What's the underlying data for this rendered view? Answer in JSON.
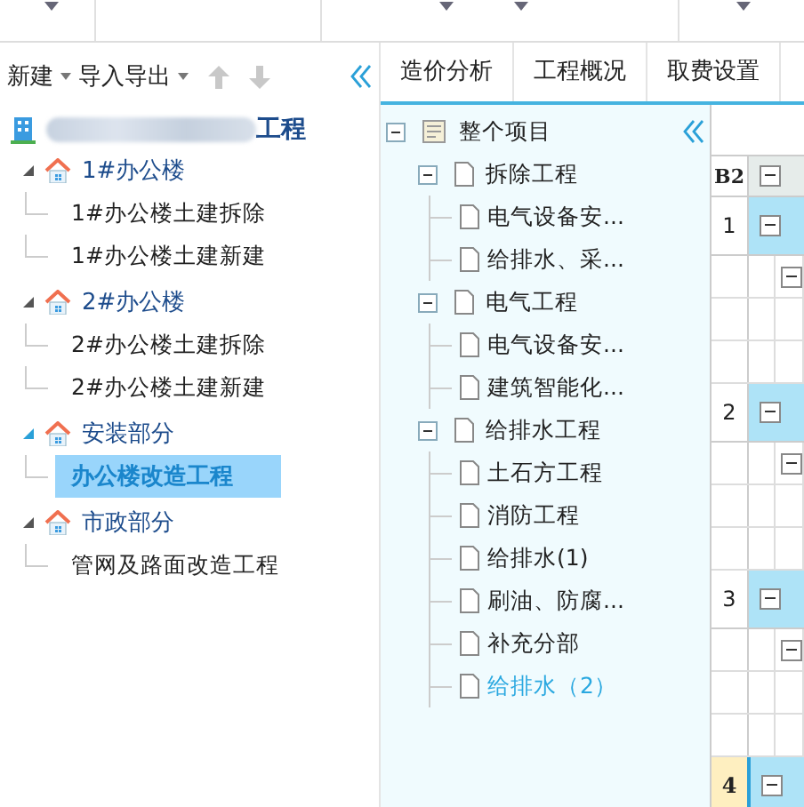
{
  "left_toolbar": {
    "new_menu": "新建",
    "import_export_menu": "导入导出"
  },
  "project_root": {
    "label": "工程"
  },
  "left_tree": [
    {
      "label": "1#办公楼",
      "expanded": true,
      "children": [
        {
          "label": "1#办公楼土建拆除",
          "selected": false
        },
        {
          "label": "1#办公楼土建新建",
          "selected": false
        }
      ]
    },
    {
      "label": "2#办公楼",
      "expanded": true,
      "children": [
        {
          "label": "2#办公楼土建拆除",
          "selected": false
        },
        {
          "label": "2#办公楼土建新建",
          "selected": false
        }
      ]
    },
    {
      "label": "安装部分",
      "expanded": true,
      "children": [
        {
          "label": "办公楼改造工程",
          "selected": true
        }
      ]
    },
    {
      "label": "市政部分",
      "expanded": true,
      "children": [
        {
          "label": "管网及路面改造工程",
          "selected": false
        }
      ]
    }
  ],
  "tabs": [
    {
      "label": "造价分析",
      "selected": false
    },
    {
      "label": "工程概况",
      "selected": false
    },
    {
      "label": "取费设置",
      "selected": false
    }
  ],
  "project_tree": {
    "label": "整个项目",
    "expanded": true,
    "children": [
      {
        "label": "拆除工程",
        "expanded": true,
        "children": [
          {
            "label": "电气设备安...",
            "selected": false
          },
          {
            "label": "给排水、采...",
            "selected": false
          }
        ]
      },
      {
        "label": "电气工程",
        "expanded": true,
        "children": [
          {
            "label": "电气设备安...",
            "selected": false
          },
          {
            "label": "建筑智能化...",
            "selected": false
          }
        ]
      },
      {
        "label": "给排水工程",
        "expanded": true,
        "children": [
          {
            "label": "土石方工程",
            "selected": false
          },
          {
            "label": "消防工程",
            "selected": false
          },
          {
            "label": "给排水(1)",
            "selected": false
          },
          {
            "label": "刷油、防腐...",
            "selected": false
          },
          {
            "label": "补充分部",
            "selected": false
          },
          {
            "label": "给排水（2）",
            "selected": true
          }
        ]
      }
    ]
  },
  "grid": {
    "corner": "B2",
    "rows": [
      {
        "number": "1",
        "selected": false
      },
      {
        "number": "2",
        "selected": false
      },
      {
        "number": "3",
        "selected": false
      },
      {
        "number": "4",
        "selected": true
      }
    ]
  }
}
